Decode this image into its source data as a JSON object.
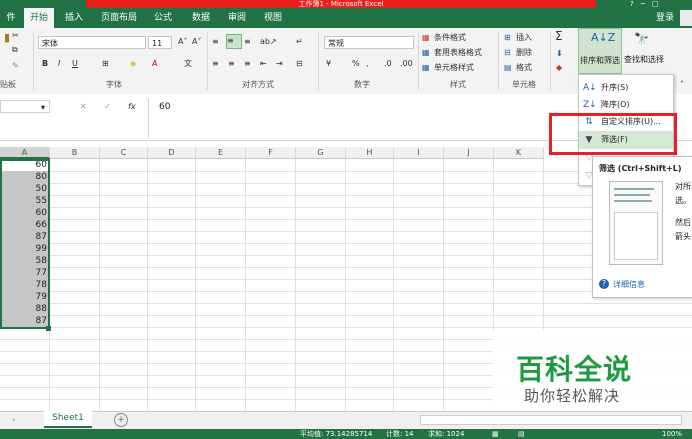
{
  "window": {
    "title": "工作簿1 - Microsoft Excel"
  },
  "tabs": [
    {
      "label": "件"
    },
    {
      "label": "开始"
    },
    {
      "label": "插入"
    },
    {
      "label": "页面布局"
    },
    {
      "label": "公式"
    },
    {
      "label": "数据"
    },
    {
      "label": "审阅"
    },
    {
      "label": "视图"
    }
  ],
  "account": {
    "login": "登录"
  },
  "ribbon": {
    "clipboard_label": "贴板",
    "font": {
      "name": "宋体",
      "size": "11",
      "label": "字体",
      "bold": "B",
      "italic": "I",
      "underline": "U"
    },
    "alignment_label": "对齐方式",
    "number": {
      "format": "常规",
      "label": "数字",
      "percent": "%",
      "comma": ","
    },
    "styles": {
      "conditional": "条件格式",
      "table": "套用表格格式",
      "cell": "单元格样式",
      "label": "样式"
    },
    "cells": {
      "insert": "插入",
      "delete": "删除",
      "format": "格式",
      "label": "单元格"
    },
    "editing": {
      "sort_filter": "排序和筛选",
      "find_select": "查找和选择",
      "sum": "Σ"
    }
  },
  "formula_bar": {
    "fx": "fx",
    "value": "60"
  },
  "columns": [
    "A",
    "B",
    "C",
    "D",
    "E",
    "F",
    "G",
    "H",
    "I",
    "J",
    "K"
  ],
  "cells_a": [
    "60",
    "80",
    "50",
    "55",
    "60",
    "66",
    "87",
    "99",
    "58",
    "77",
    "78",
    "79",
    "88",
    "87"
  ],
  "sort_menu": {
    "items": [
      {
        "icon": "A↓",
        "label": "升序(S)"
      },
      {
        "icon": "Z↓",
        "label": "降序(O)"
      },
      {
        "icon": "⇅",
        "label": "自定义排序(U)..."
      },
      {
        "icon": "▼",
        "label": "筛选(F)"
      },
      {
        "icon": "▽",
        "label": ""
      },
      {
        "icon": "▽",
        "label": ""
      }
    ]
  },
  "tooltip": {
    "title": "筛选 (Ctrl+Shift+L)",
    "line1": "对所",
    "line2": "选。",
    "line3": "然后",
    "line4": "箭头",
    "more": "详细信息"
  },
  "sheet": {
    "tab": "Sheet1",
    "add": "+"
  },
  "status": {
    "average": "平均值: 73.14285714",
    "count": "计数: 14",
    "sum": "求和: 1024",
    "zoom": "100%"
  },
  "watermark": {
    "title": "百科全说",
    "subtitle": "助你轻松解决"
  },
  "colors": {
    "excel_green": "#217346",
    "highlight_red": "#e32128",
    "selection_gray": "#c6c6c6"
  }
}
